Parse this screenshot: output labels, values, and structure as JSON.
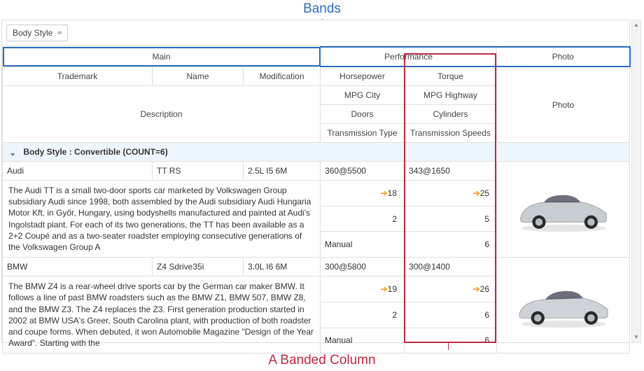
{
  "annotations": {
    "top": "Bands",
    "bottom": "A Banded Column"
  },
  "group_chip": {
    "label": "Body Style",
    "sort_glyph": "≐"
  },
  "bands": {
    "main": "Main",
    "performance": "Performance",
    "photo": "Photo"
  },
  "columns": {
    "trademark": "Trademark",
    "name": "Name",
    "modification": "Modification",
    "description": "Description",
    "horsepower": "Horsepower",
    "torque": "Torque",
    "mpg_city": "MPG City",
    "mpg_highway": "MPG Highway",
    "doors": "Doors",
    "cylinders": "Cylinders",
    "transmission_type": "Transmission Type",
    "transmission_speeds": "Transmission Speeds",
    "photo": "Photo"
  },
  "group": {
    "header": "Body Style : Convertible (COUNT=6)"
  },
  "rows": [
    {
      "trademark": "Audi",
      "name": "TT RS",
      "modification": "2.5L I5 6M",
      "horsepower": "360@5500",
      "torque": "343@1650",
      "description": "The Audi TT is a small two-door sports car marketed by Volkswagen Group subsidiary Audi since 1998, both assembled by the Audi subsidiary Audi Hungaria Motor Kft. in Győr, Hungary, using bodyshells manufactured and painted at Audi's Ingolstadt plant. For each of its two generations, the TT has been available as a 2+2 Coupé and as a two-seater roadster employing consecutive generations of the Volkswagen Group A",
      "mpg_city": "18",
      "mpg_highway": "25",
      "doors": "2",
      "cylinders": "5",
      "transmission_type": "Manual",
      "transmission_speeds": "6",
      "car_color": "#c8cdd2"
    },
    {
      "trademark": "BMW",
      "name": "Z4 Sdrive35i",
      "modification": "3.0L I6 6M",
      "horsepower": "300@5800",
      "torque": "300@1400",
      "description": "The BMW Z4 is a rear-wheel drive sports car by the German car maker BMW. It follows a line of past BMW roadsters such as the BMW Z1, BMW 507, BMW Z8, and the BMW Z3. The Z4 replaces the Z3. First generation production started in 2002 at BMW USA's Greer, South Carolina plant, with production of both roadster and coupe forms. When debuted, it won Automobile Magazine \"Design of the Year Award\". Starting with the",
      "mpg_city": "19",
      "mpg_highway": "26",
      "doors": "2",
      "cylinders": "6",
      "transmission_type": "Manual",
      "transmission_speeds": "6",
      "car_color": "#cfd3d8"
    }
  ]
}
